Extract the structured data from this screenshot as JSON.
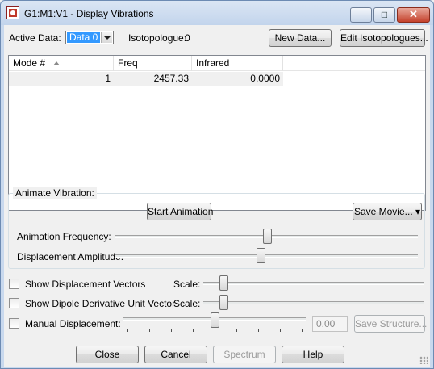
{
  "window": {
    "title": "G1:M1:V1 - Display Vibrations",
    "controls": {
      "minimize_icon": "minimize-icon",
      "maximize_icon": "maximize-icon",
      "close_icon": "close-icon"
    }
  },
  "top": {
    "active_data_label": "Active Data:",
    "active_data_value": "Data 0",
    "isotopologue_label": "Isotopologue:",
    "isotopologue_value": "0",
    "new_data_button": "New Data...",
    "edit_isotopologues_button": "Edit Isotopologues..."
  },
  "table": {
    "columns": [
      "Mode #",
      "Freq",
      "Infrared"
    ],
    "rows": [
      {
        "mode": "1",
        "freq": "2457.33",
        "infrared": "0.0000"
      }
    ]
  },
  "animate": {
    "group_label": "Animate Vibration:",
    "start_button": "Start Animation",
    "save_movie_button": "Save Movie...",
    "frequency_label": "Animation Frequency:",
    "frequency_level": 0.5,
    "amplitude_label": "Displacement Amplitude:",
    "amplitude_level": 0.48
  },
  "options": {
    "show_displacement_vectors": {
      "label": "Show Displacement Vectors",
      "checked": false,
      "scale_label": "Scale:",
      "scale_level": 0.09
    },
    "show_dipole_vector": {
      "label": "Show Dipole Derivative Unit Vector",
      "checked": false,
      "scale_label": "Scale:",
      "scale_level": 0.09
    },
    "manual_displacement": {
      "label": "Manual Displacement:",
      "checked": false,
      "value": "0.00",
      "level": 0.5,
      "save_structure_button": "Save Structure..."
    }
  },
  "footer": {
    "close_button": "Close",
    "cancel_button": "Cancel",
    "spectrum_button": "Spectrum",
    "help_button": "Help"
  },
  "colors": {
    "selection": "#3399ff",
    "titlebar": "#c9d9ee",
    "close_button": "#c4412b"
  }
}
